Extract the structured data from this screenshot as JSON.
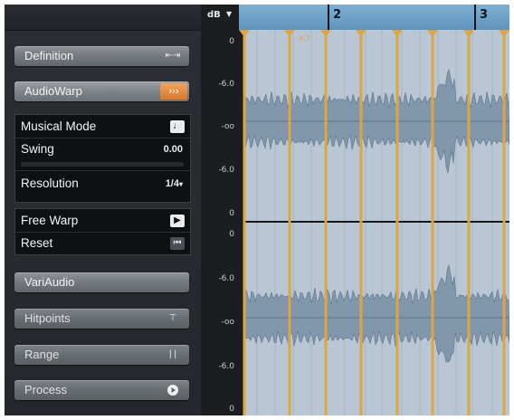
{
  "inspector": {
    "definition": {
      "label": "Definition",
      "icon": "definition-icon"
    },
    "audiowarp": {
      "label": "AudioWarp",
      "icon": "audiowarp-icon"
    },
    "audiowarp_panel": {
      "musical_mode": {
        "label": "Musical Mode",
        "icon": "musical-note-icon"
      },
      "swing": {
        "label": "Swing",
        "value": "0.00"
      },
      "resolution": {
        "label": "Resolution",
        "value": "1/4"
      },
      "free_warp": {
        "label": "Free Warp",
        "icon": "free-warp-arrow-icon"
      },
      "reset": {
        "label": "Reset",
        "icon": "reset-icon"
      }
    },
    "variaudio": {
      "label": "VariAudio"
    },
    "hitpoints": {
      "label": "Hitpoints",
      "icon": "hitpoints-icon"
    },
    "range": {
      "label": "Range",
      "icon": "range-icon"
    },
    "process": {
      "label": "Process",
      "icon": "play-circle-icon"
    }
  },
  "editor": {
    "db_menu": {
      "label": "dB"
    },
    "ruler": {
      "bars": [
        "2",
        "3"
      ]
    },
    "channel_scale": [
      "0",
      "-6.0",
      "-oo",
      "-6.0",
      "0"
    ],
    "warp_tab_marker": "4.7",
    "colors": {
      "ruler": "#6fa3c9",
      "waveform": "#8097ac",
      "warp_marker": "#e0a540",
      "background": "#b9c7d5"
    }
  }
}
